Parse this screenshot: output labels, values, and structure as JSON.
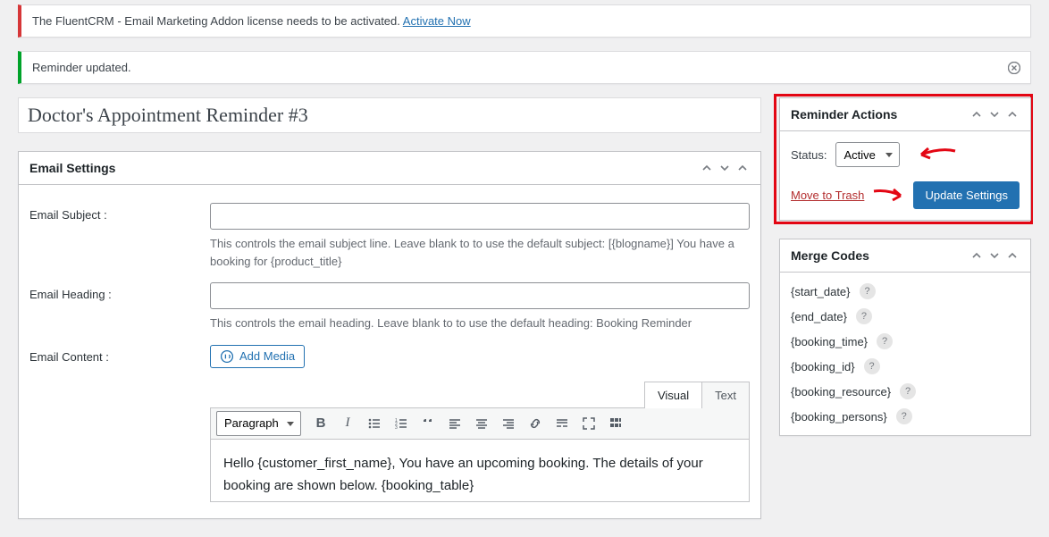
{
  "notices": {
    "fluentcrm_text": "The FluentCRM - Email Marketing Addon license needs to be activated. ",
    "fluentcrm_link": "Activate Now",
    "updated": "Reminder updated."
  },
  "title": "Doctor's Appointment Reminder #3",
  "email_settings": {
    "heading": "Email Settings",
    "subject_label": "Email Subject :",
    "subject_value": "",
    "subject_help": "This controls the email subject line. Leave blank to to use the default subject: [{blogname}] You have a booking for {product_title}",
    "heading_label": "Email Heading :",
    "heading_value": "",
    "heading_help": "This controls the email heading. Leave blank to to use the default heading: Booking Reminder",
    "content_label": "Email Content :",
    "add_media": "Add Media",
    "tabs": {
      "visual": "Visual",
      "text": "Text"
    },
    "paragraph": "Paragraph",
    "content_body": "Hello {customer_first_name}, You have an upcoming booking. The details of your booking are shown below. {booking_table}"
  },
  "reminder_actions": {
    "heading": "Reminder Actions",
    "status_label": "Status:",
    "status_value": "Active",
    "trash": "Move to Trash",
    "update": "Update Settings"
  },
  "merge_codes": {
    "heading": "Merge Codes",
    "items": [
      "{start_date}",
      "{end_date}",
      "{booking_time}",
      "{booking_id}",
      "{booking_resource}",
      "{booking_persons}"
    ]
  }
}
